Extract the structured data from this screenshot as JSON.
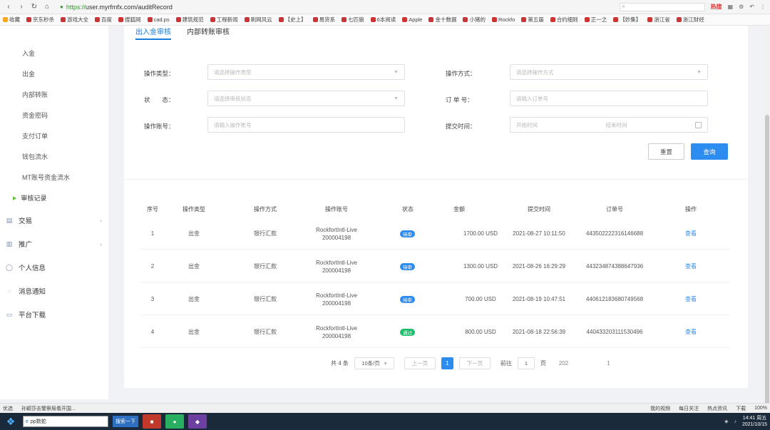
{
  "browser": {
    "url_scheme": "https://",
    "url_rest": "user.myrfmfx.com/auditRecord",
    "search_placeholder": "",
    "hot_label": "热搜"
  },
  "bookmarks": [
    "收藏",
    "京东秒杀",
    "游戏大全",
    "百度",
    "搜狐网",
    "cad.ps",
    "建筑规范",
    "工程新闻",
    "刷网风云",
    "【史上】",
    "易货系",
    "七匹狼",
    "6本阅读",
    "Apple",
    "金十数据",
    "小猪的",
    "Rockfo",
    "第五届",
    "合约细则",
    "正一之",
    "【妙集】",
    "浙江省",
    "浙江财经"
  ],
  "sidebar": {
    "sub_items": [
      "入金",
      "出金",
      "内部转账",
      "资金密码",
      "支付订单",
      "钱包流水",
      "MT账号资金流水"
    ],
    "active_item": "审核记录",
    "main_items": [
      {
        "label": "交易",
        "icon": "trade-icon",
        "arrow": "›"
      },
      {
        "label": "推广",
        "icon": "promo-icon",
        "arrow": "›"
      },
      {
        "label": "个人信息",
        "icon": "user-icon",
        "arrow": ""
      },
      {
        "label": "消息通知",
        "icon": "message-icon",
        "arrow": ""
      },
      {
        "label": "平台下载",
        "icon": "download-icon",
        "arrow": ""
      }
    ]
  },
  "tabs": [
    "出入金审核",
    "内部转账审核"
  ],
  "filters": {
    "op_type_label": "操作类型：",
    "op_type_placeholder": "请选择操作类型",
    "op_method_label": "操作方式：",
    "op_method_placeholder": "请选择操作方式",
    "status_label": "状　　态：",
    "status_placeholder": "请选择审核状态",
    "order_label": "订 单 号：",
    "order_placeholder": "请输入订单号",
    "account_label": "操作账号：",
    "account_placeholder": "请输入操作账号",
    "time_label": "提交时间：",
    "start_placeholder": "开始时间",
    "end_placeholder": "结束时间",
    "reset_label": "重置",
    "query_label": "查询"
  },
  "table": {
    "headers": [
      "序号",
      "操作类型",
      "操作方式",
      "操作账号",
      "状态",
      "金额",
      "提交时间",
      "订单号",
      "操作"
    ],
    "rows": [
      {
        "no": "1",
        "type": "出金",
        "method": "银行汇款",
        "account1": "RockfortIntl-Live",
        "account2": "200004198",
        "status": "待审",
        "status_color": "#2d8cf0",
        "amount": "1700.00 USD",
        "time": "2021-08-27 10:11:50",
        "order": "443502222316146688",
        "action": "查看"
      },
      {
        "no": "2",
        "type": "出金",
        "method": "银行汇款",
        "account1": "RockfortIntl-Live",
        "account2": "200004198",
        "status": "待审",
        "status_color": "#2d8cf0",
        "amount": "1300.00 USD",
        "time": "2021-08-26 16:29:29",
        "order": "443234874388647936",
        "action": "查看"
      },
      {
        "no": "3",
        "type": "出金",
        "method": "银行汇款",
        "account1": "RockfortIntl-Live",
        "account2": "200004198",
        "status": "待审",
        "status_color": "#2d8cf0",
        "amount": "700.00 USD",
        "time": "2021-08-19 10:47:51",
        "order": "440612183680749568",
        "action": "查看"
      },
      {
        "no": "4",
        "type": "出金",
        "method": "银行汇款",
        "account1": "RockfortIntl-Live",
        "account2": "200004198",
        "status": "通过",
        "status_color": "#19be6b",
        "amount": "800.00 USD",
        "time": "2021-08-18 22:56:39",
        "order": "440433203111530496",
        "action": "查看"
      }
    ]
  },
  "pager": {
    "total": "共 4 条",
    "page_size": "10条/页",
    "prev": "上一页",
    "current": "1",
    "next": "下一页",
    "goto_label": "前往",
    "goto_value": "1",
    "page_suffix": "页",
    "extra1": "202",
    "extra2": "1"
  },
  "status_bar": {
    "left1": "优选",
    "left2": "孙颖莎去警察局看开国...",
    "items": [
      "我的视频",
      "每日关注",
      "热点资讯",
      "下载",
      "100%"
    ]
  },
  "taskbar": {
    "search_value": "pp数蛇",
    "search_btn": "搜索一下",
    "time": "14:41 周五",
    "date": "2021/10/15"
  }
}
